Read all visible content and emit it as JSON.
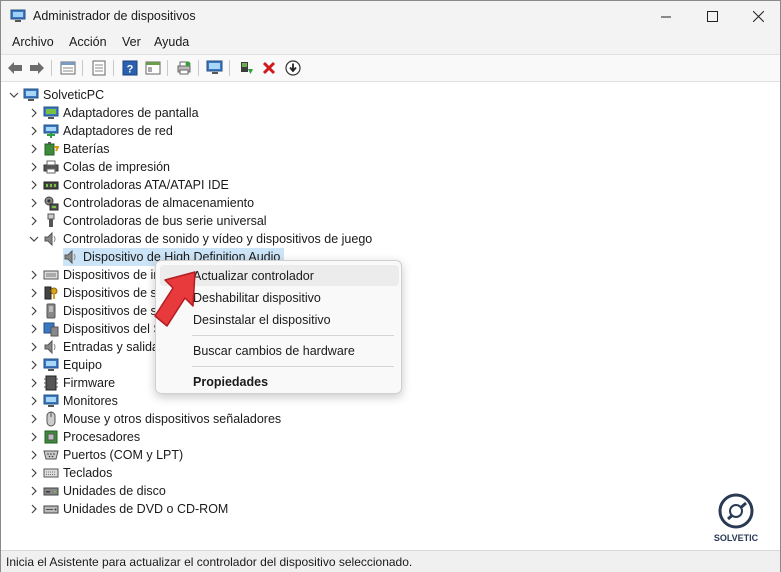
{
  "window": {
    "title": "Administrador de dispositivos"
  },
  "menu": [
    "Archivo",
    "Acción",
    "Ver",
    "Ayuda"
  ],
  "toolbar": [
    "back-icon",
    "forward-icon",
    "properties-icon",
    "list-icon",
    "help-icon",
    "view-icon",
    "print-icon",
    "scan-icon",
    "enable-icon",
    "uninstall-icon",
    "download-icon"
  ],
  "tree": {
    "root": "SolveticPC",
    "items": [
      "Adaptadores de pantalla",
      "Adaptadores de red",
      "Baterías",
      "Colas de impresión",
      "Controladoras ATA/ATAPI IDE",
      "Controladoras de almacenamiento",
      "Controladoras de bus serie universal",
      "Controladoras de sonido y vídeo y dispositivos de juego",
      "Dispositivo de High Definition Audio",
      "Dispositivos de in",
      "Dispositivos de s",
      "Dispositivos de s",
      "Dispositivos del S",
      "Entradas y salida",
      "Equipo",
      "Firmware",
      "Monitores",
      "Mouse y otros dispositivos señaladores",
      "Procesadores",
      "Puertos (COM y LPT)",
      "Teclados",
      "Unidades de disco",
      "Unidades de DVD o CD-ROM"
    ]
  },
  "context_menu": {
    "update": "Actualizar controlador",
    "disable": "Deshabilitar dispositivo",
    "uninstall": "Desinstalar el dispositivo",
    "scan": "Buscar cambios de hardware",
    "properties": "Propiedades"
  },
  "status": "Inicia el Asistente para actualizar el controlador del dispositivo seleccionado.",
  "colors": {
    "selection": "#cce4f7",
    "arrow": "#e8393d",
    "uninstall": "#d0191c"
  }
}
